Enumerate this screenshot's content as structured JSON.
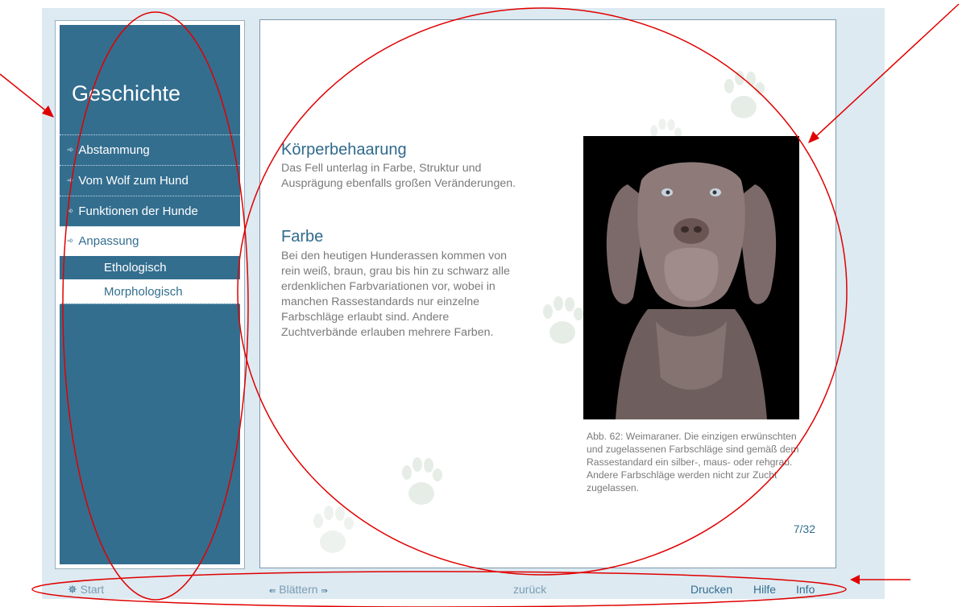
{
  "sidebar": {
    "title": "Geschichte",
    "items": [
      {
        "label": "Abstammung"
      },
      {
        "label": "Vom Wolf zum Hund"
      },
      {
        "label": "Funktionen der Hunde"
      },
      {
        "label": "Anpassung"
      }
    ],
    "sub_items": [
      {
        "label": "Ethologisch"
      },
      {
        "label": "Morphologisch"
      }
    ]
  },
  "content": {
    "section1_heading": "Körperbehaarung",
    "section1_text": "Das Fell unterlag in Farbe, Struktur und Ausprägung ebenfalls großen Veränderungen.",
    "section2_heading": "Farbe",
    "section2_text": "Bei den heutigen Hunderassen kommen von rein weiß, braun, grau bis hin zu schwarz alle erdenklichen Farbvariationen vor, wobei in manchen Rassestandards nur einzelne Farbschläge erlaubt sind. Andere Zuchtverbände erlauben mehrere Farben.",
    "caption": "Abb. 62: Weimaraner. Die einzigen erwünschten und zugelassenen Farbschläge sind gemäß dem Rassestandard ein silber-, maus- oder rehgrau. Andere Farbschläge werden nicht zur Zucht zugelassen.",
    "page_number": "7/32"
  },
  "footer": {
    "start": "Start",
    "blaettern": "Blättern",
    "zurueck": "zurück",
    "drucken": "Drucken",
    "hilfe": "Hilfe",
    "info": "Info"
  },
  "colors": {
    "sidebar": "#336e8f",
    "background": "#ddeaf2",
    "heading": "#2f6a8c",
    "annotation": "#e00000"
  }
}
